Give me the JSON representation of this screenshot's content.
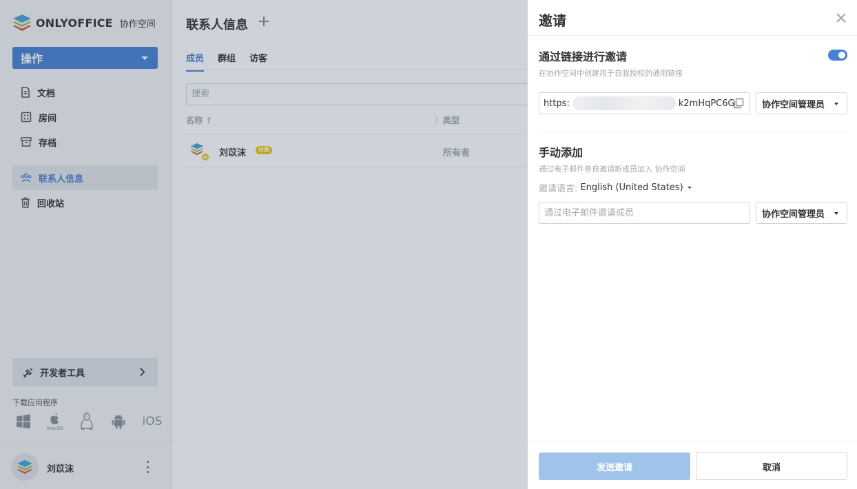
{
  "logo": {
    "name": "ONLYOFFICE",
    "subtitle": "协作空间"
  },
  "sidebar": {
    "actions_label": "操作",
    "items": [
      {
        "label": "文档",
        "icon": "document-icon"
      },
      {
        "label": "房间",
        "icon": "rooms-icon"
      },
      {
        "label": "存档",
        "icon": "archive-icon"
      },
      {
        "label": "联系人信息",
        "icon": "contacts-icon",
        "active": true
      },
      {
        "label": "回收站",
        "icon": "trash-icon"
      }
    ],
    "developer_tools": "开发者工具",
    "download_label": "下载应用程序",
    "apps": {
      "macos_label": "macOS",
      "ios_label": "iOS"
    },
    "profile_name": "刘苡沫"
  },
  "main": {
    "title": "联系人信息",
    "tabs": [
      "成员",
      "群组",
      "访客"
    ],
    "search_placeholder": "搜索",
    "columns": {
      "name": "名称 ↑",
      "type": "类型"
    },
    "rows": [
      {
        "name": "刘苡沫",
        "badge": "付费",
        "owner_mark": "O",
        "type": "所有者"
      }
    ]
  },
  "panel": {
    "title": "邀请",
    "link_section": {
      "title": "通过链接进行邀请",
      "description": "在协作空间中创建用于自我授权的通用链接",
      "enabled": true,
      "link_prefix": "https:",
      "link_suffix": "k2mHqPC6G",
      "role": "协作空间管理员"
    },
    "manual_section": {
      "title": "手动添加",
      "description": "通过电子邮件亲自邀请新成员加入 协作空间",
      "language_label": "邀请语言:",
      "language_value": "English (United States)",
      "email_placeholder": "通过电子邮件邀请成员",
      "role": "协作空间管理员"
    },
    "send_label": "发送邀请",
    "cancel_label": "取消"
  },
  "colors": {
    "accent": "#4781d1",
    "send_disabled": "#a0c3ec",
    "paid_badge": "#edc409"
  }
}
